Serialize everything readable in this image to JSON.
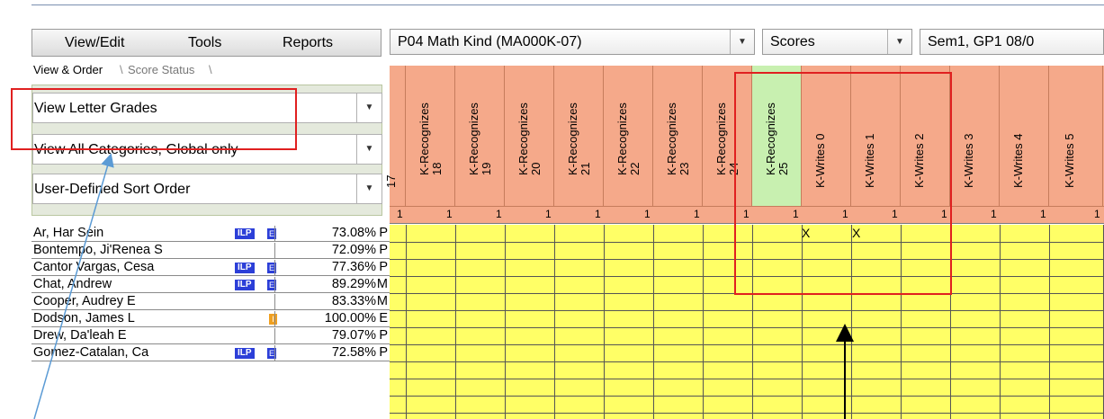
{
  "menubar": {
    "items": [
      "View/Edit",
      "Tools",
      "Reports"
    ]
  },
  "selectors": {
    "class": "P04  Math Kind (MA000K-07)",
    "view": "Scores",
    "period": "Sem1, GP1 08/0"
  },
  "tabs": [
    "View & Order",
    "Score Status"
  ],
  "options": {
    "grades": "View Letter Grades",
    "categories": "View All Categories, Global only",
    "sort": "User-Defined Sort Order"
  },
  "assignments": [
    "17",
    "K-Recognizes\n18",
    "K-Recognizes\n19",
    "K-Recognizes\n20",
    "K-Recognizes\n21",
    "K-Recognizes\n22",
    "K-Recognizes\n23",
    "K-Recognizes\n24",
    "K-Recognizes\n25",
    "K-Writes 0",
    "K-Writes 1",
    "K-Writes 2",
    "K-Writes 3",
    "K-Writes 4",
    "K-Writes 5"
  ],
  "points": [
    "1",
    "1",
    "1",
    "1",
    "1",
    "1",
    "1",
    "1",
    "1",
    "1",
    "1",
    "1",
    "1",
    "1",
    "1"
  ],
  "students": [
    {
      "name": "Ar, Har Sein",
      "ilp": "ILP",
      "e": "E",
      "pct": "73.08%",
      "grade": "P"
    },
    {
      "name": "Bontempo, Ji'Renea S",
      "pct": "72.09%",
      "grade": "P"
    },
    {
      "name": "Cantor Vargas, Cesa",
      "ilp": "ILP",
      "e": "E",
      "pct": "77.36%",
      "grade": "P"
    },
    {
      "name": "Chat, Andrew",
      "ilp": "ILP",
      "e": "E",
      "pct": "89.29%",
      "grade": "M"
    },
    {
      "name": "Cooper, Audrey E",
      "pct": "83.33%",
      "grade": "M"
    },
    {
      "name": "Dodson, James L",
      "i": "I",
      "pct": "100.00%",
      "grade": "E"
    },
    {
      "name": "Drew, Da'leah E",
      "pct": "79.07%",
      "grade": "P"
    },
    {
      "name": "Gomez-Catalan, Ca",
      "ilp": "ILP",
      "e": "E",
      "pct": "72.58%",
      "grade": "P"
    }
  ],
  "scores": {
    "row0": [
      "X",
      "X"
    ]
  },
  "colors": {
    "header": "#f5a98a",
    "highlight_header": "#c8f0b0",
    "cells": "#ffff66",
    "annotation": "#e02020"
  }
}
